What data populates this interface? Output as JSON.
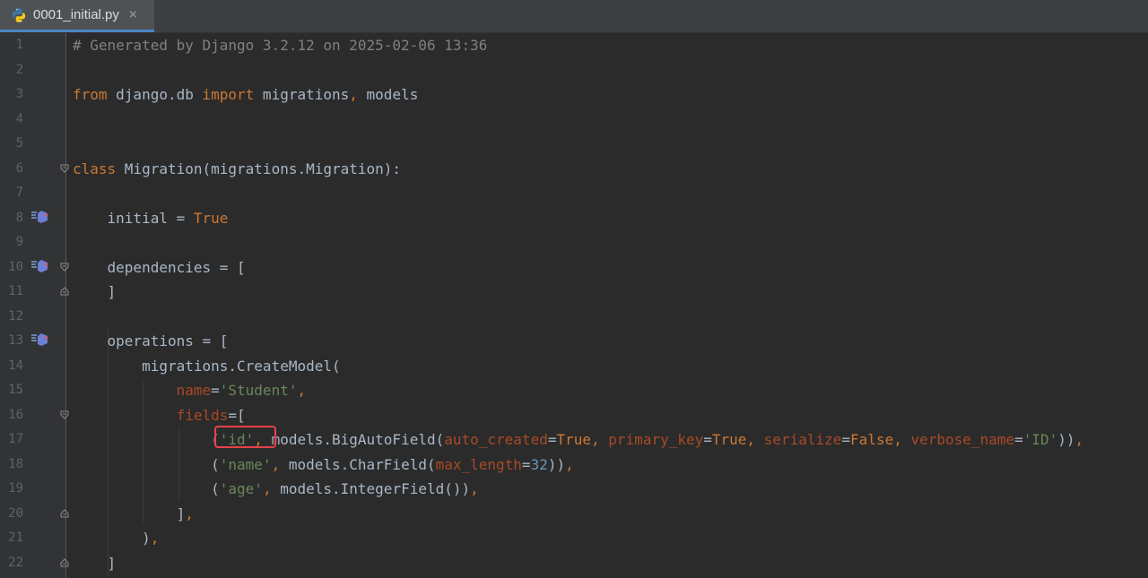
{
  "tab": {
    "filename": "0001_initial.py",
    "close_glyph": "×",
    "icon": "python-file-icon"
  },
  "colors": {
    "keyword": "#cc7832",
    "comment": "#808080",
    "string": "#6a8759",
    "number": "#6897bb",
    "param": "#aa4926",
    "text": "#a9b7c6",
    "highlight_box": "#e8414b"
  },
  "lines": [
    {
      "n": "1",
      "tokens": [
        {
          "t": "# Generated by Django 3.2.12 on 2025-02-06 13:36",
          "c": "cm"
        }
      ]
    },
    {
      "n": "2",
      "tokens": []
    },
    {
      "n": "3",
      "tokens": [
        {
          "t": "from",
          "c": "kw"
        },
        {
          "t": " django.db "
        },
        {
          "t": "import",
          "c": "kw"
        },
        {
          "t": " migrations"
        },
        {
          "t": ",",
          "c": "kw"
        },
        {
          "t": " models"
        }
      ]
    },
    {
      "n": "4",
      "tokens": []
    },
    {
      "n": "5",
      "tokens": []
    },
    {
      "n": "6",
      "tokens": [
        {
          "t": "class",
          "c": "kw"
        },
        {
          "t": " Migration(migrations.Migration):"
        }
      ]
    },
    {
      "n": "7",
      "tokens": []
    },
    {
      "n": "8",
      "tokens": [
        {
          "t": "    initial = "
        },
        {
          "t": "True",
          "c": "kw"
        }
      ]
    },
    {
      "n": "9",
      "tokens": []
    },
    {
      "n": "10",
      "tokens": [
        {
          "t": "    dependencies = ["
        }
      ]
    },
    {
      "n": "11",
      "tokens": [
        {
          "t": "    ]"
        }
      ]
    },
    {
      "n": "12",
      "tokens": []
    },
    {
      "n": "13",
      "tokens": [
        {
          "t": "    operations = ["
        }
      ]
    },
    {
      "n": "14",
      "tokens": [
        {
          "t": "        migrations.CreateModel("
        }
      ]
    },
    {
      "n": "15",
      "tokens": [
        {
          "t": "            "
        },
        {
          "t": "name",
          "c": "pr"
        },
        {
          "t": "="
        },
        {
          "t": "'Student'",
          "c": "st"
        },
        {
          "t": ",",
          "c": "kw"
        }
      ]
    },
    {
      "n": "16",
      "tokens": [
        {
          "t": "            "
        },
        {
          "t": "fields",
          "c": "pr"
        },
        {
          "t": "=["
        }
      ]
    },
    {
      "n": "17",
      "tokens": [
        {
          "t": "                ("
        },
        {
          "t": "'id'",
          "c": "st"
        },
        {
          "t": ",",
          "c": "kw"
        },
        {
          "t": " models.BigAutoField("
        },
        {
          "t": "auto_created",
          "c": "pr"
        },
        {
          "t": "="
        },
        {
          "t": "True",
          "c": "kw"
        },
        {
          "t": ",",
          "c": "kw"
        },
        {
          "t": " "
        },
        {
          "t": "primary_key",
          "c": "pr"
        },
        {
          "t": "="
        },
        {
          "t": "True",
          "c": "kw"
        },
        {
          "t": ",",
          "c": "kw"
        },
        {
          "t": " "
        },
        {
          "t": "serialize",
          "c": "pr"
        },
        {
          "t": "="
        },
        {
          "t": "False",
          "c": "kw"
        },
        {
          "t": ",",
          "c": "kw"
        },
        {
          "t": " "
        },
        {
          "t": "verbose_name",
          "c": "pr"
        },
        {
          "t": "="
        },
        {
          "t": "'ID'",
          "c": "st"
        },
        {
          "t": "))"
        },
        {
          "t": ",",
          "c": "kw"
        }
      ]
    },
    {
      "n": "18",
      "tokens": [
        {
          "t": "                ("
        },
        {
          "t": "'name'",
          "c": "st"
        },
        {
          "t": ",",
          "c": "kw"
        },
        {
          "t": " models.CharField("
        },
        {
          "t": "max_length",
          "c": "pr"
        },
        {
          "t": "="
        },
        {
          "t": "32",
          "c": "nm"
        },
        {
          "t": "))"
        },
        {
          "t": ",",
          "c": "kw"
        }
      ]
    },
    {
      "n": "19",
      "tokens": [
        {
          "t": "                ("
        },
        {
          "t": "'age'",
          "c": "st"
        },
        {
          "t": ",",
          "c": "kw"
        },
        {
          "t": " models.IntegerField())"
        },
        {
          "t": ",",
          "c": "kw"
        }
      ]
    },
    {
      "n": "20",
      "tokens": [
        {
          "t": "            ]"
        },
        {
          "t": ",",
          "c": "kw"
        }
      ]
    },
    {
      "n": "21",
      "tokens": [
        {
          "t": "        )"
        },
        {
          "t": ",",
          "c": "kw"
        }
      ]
    },
    {
      "n": "22",
      "tokens": [
        {
          "t": "    ]"
        }
      ]
    }
  ]
}
